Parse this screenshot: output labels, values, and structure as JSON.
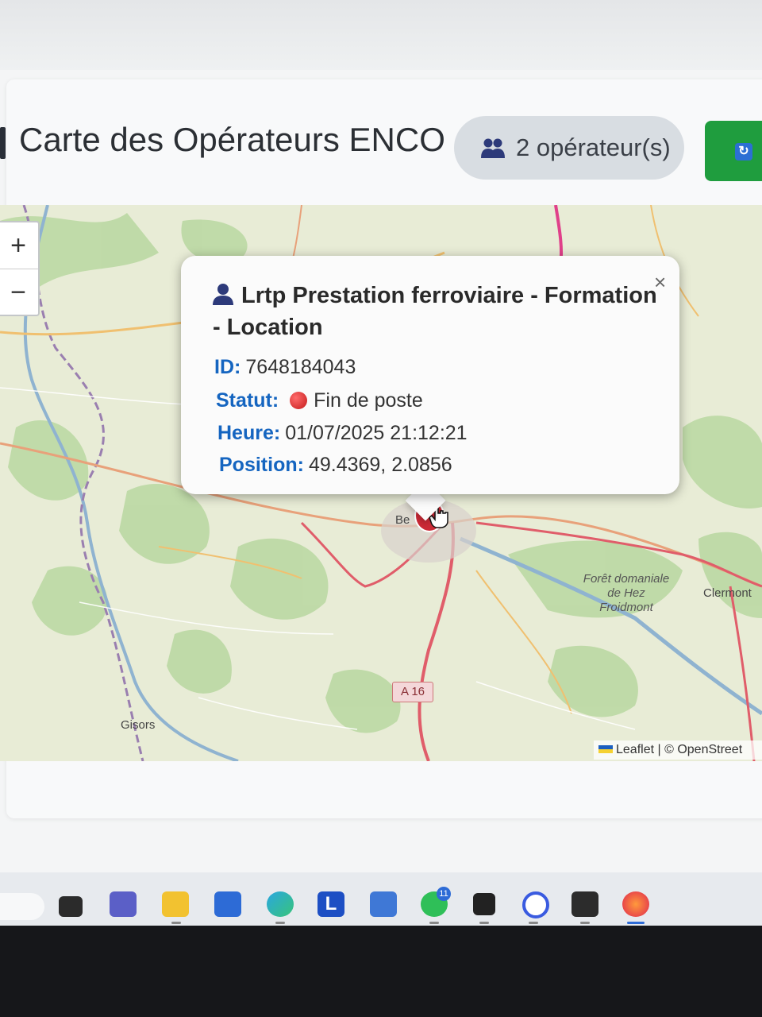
{
  "header": {
    "title": "Carte des Opérateurs ENCO",
    "operator_count": "2 opérateur(s)",
    "refresh_icon": "refresh-icon",
    "badge_icon": "users-icon"
  },
  "map": {
    "zoom_in": "+",
    "zoom_out": "−",
    "labels": {
      "city_beauvais_partial": "Be",
      "forest": "Forêt domaniale de Hez Froidmont",
      "forest_line1": "Forêt domaniale",
      "forest_line2": "de Hez",
      "forest_line3": "Froidmont",
      "clermont": "Clermont",
      "gisors": "Gisors",
      "road": "A 16"
    },
    "attribution": "Leaflet | © OpenStreet",
    "marker_color": "#cc2a36"
  },
  "popup": {
    "close": "×",
    "title": "Lrtp Prestation ferroviaire - Formation - Location",
    "id_label": "ID:",
    "id_value": "7648184043",
    "status_label": "Statut:",
    "status_value": "Fin de poste",
    "status_color": "#d32f2f",
    "time_label": "Heure:",
    "time_value": "01/07/2025 21:12:21",
    "position_label": "Position:",
    "position_value": "49.4369, 2.0856"
  },
  "taskbar": {
    "apps": [
      "task-view-icon",
      "teams-icon",
      "file-explorer-icon",
      "store-icon",
      "edge-icon",
      "app-l-icon",
      "app-editor-icon",
      "whatsapp-icon",
      "app-dark-icon",
      "app-ring-icon",
      "terminal-icon",
      "firefox-icon"
    ],
    "whatsapp_badge": "11"
  }
}
